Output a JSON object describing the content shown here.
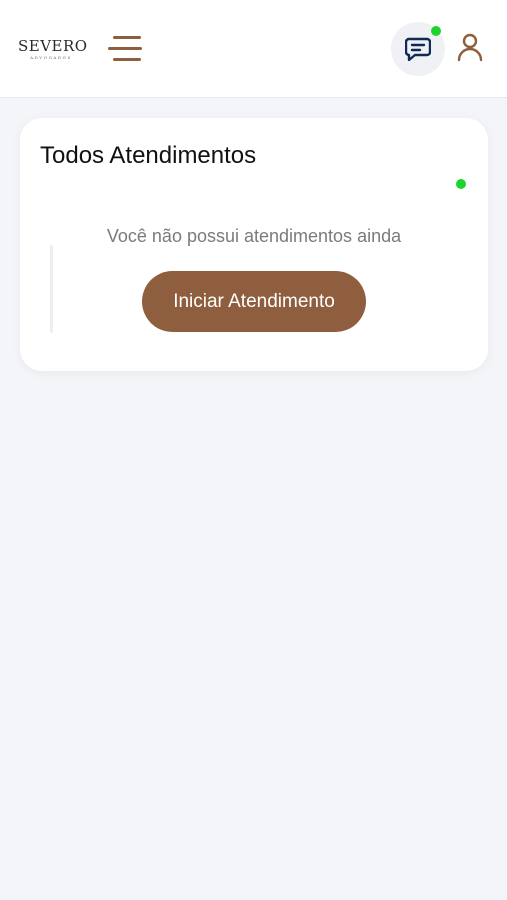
{
  "header": {
    "logo_main": "SEVERO",
    "logo_sub": "ADVOGADOS",
    "menu_icon": "hamburger-menu-icon",
    "chat_icon": "chat-icon",
    "user_icon": "user-icon"
  },
  "card": {
    "title": "Todos Atendimentos",
    "empty_message": "Você não possui atendimentos ainda",
    "start_button_label": "Iniciar Atendimento"
  },
  "colors": {
    "brand": "#8e5e3e",
    "online_dot": "#1ed32d",
    "background": "#f4f5f9",
    "chat_icon": "#0f2a57"
  }
}
